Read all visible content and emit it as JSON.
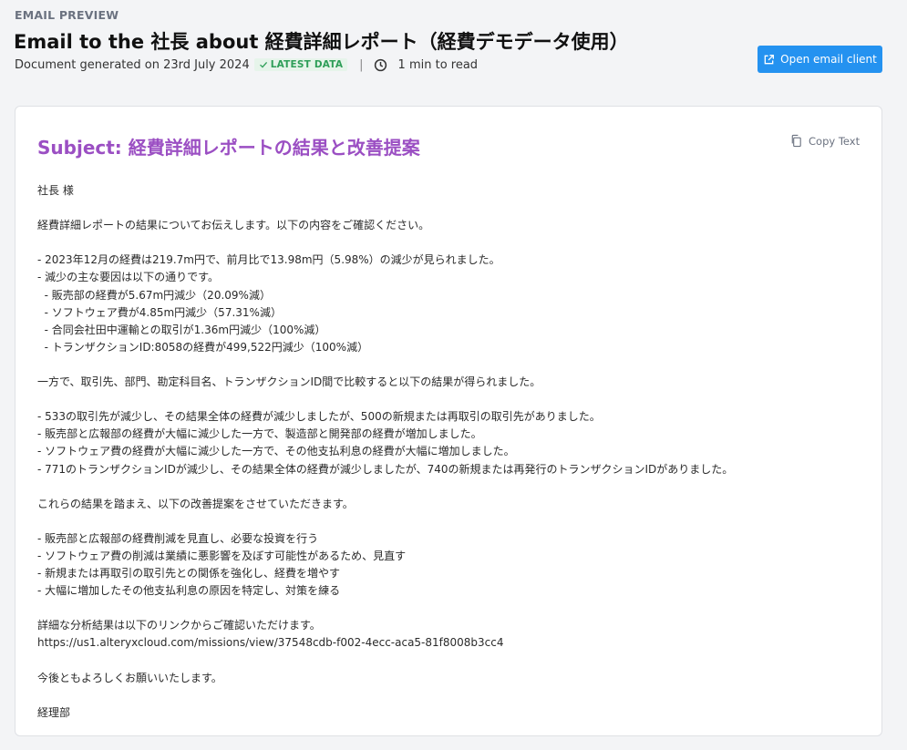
{
  "header": {
    "eyebrow": "EMAIL PREVIEW",
    "title": "Email to the 社長 about 経費詳細レポート（経費デモデータ使用）",
    "generated": "Document generated on 23rd July 2024",
    "badge": "LATEST DATA",
    "separator": "|",
    "read_time": "1 min to read",
    "open_client_label": "Open email client",
    "accent_color": "#2492f0",
    "badge_color": "#2e9e58"
  },
  "email": {
    "subject": "Subject: 経費詳細レポートの結果と改善提案",
    "subject_color": "#9b4fc3",
    "copy_label": "Copy Text",
    "lines": [
      "社長 様",
      "",
      "経費詳細レポートの結果についてお伝えします。以下の内容をご確認ください。",
      "",
      "- 2023年12月の経費は219.7m円で、前月比で13.98m円（5.98%）の減少が見られました。",
      "- 減少の主な要因は以下の通りです。",
      "  - 販売部の経費が5.67m円減少（20.09%減）",
      "  - ソフトウェア費が4.85m円減少（57.31%減）",
      "  - 合同会社田中運輸との取引が1.36m円減少（100%減）",
      "  - トランザクションID:8058の経費が499,522円減少（100%減）",
      "",
      "一方で、取引先、部門、勘定科目名、トランザクションID間で比較すると以下の結果が得られました。",
      "",
      "- 533の取引先が減少し、その結果全体の経費が減少しましたが、500の新規または再取引の取引先がありました。",
      "- 販売部と広報部の経費が大幅に減少した一方で、製造部と開発部の経費が増加しました。",
      "- ソフトウェア費の経費が大幅に減少した一方で、その他支払利息の経費が大幅に増加しました。",
      "- 771のトランザクションIDが減少し、その結果全体の経費が減少しましたが、740の新規または再発行のトランザクションIDがありました。",
      "",
      "これらの結果を踏まえ、以下の改善提案をさせていただきます。",
      "",
      "- 販売部と広報部の経費削減を見直し、必要な投資を行う",
      "- ソフトウェア費の削減は業績に悪影響を及ぼす可能性があるため、見直す",
      "- 新規または再取引の取引先との関係を強化し、経費を増やす",
      "- 大幅に増加したその他支払利息の原因を特定し、対策を練る",
      "",
      "詳細な分析結果は以下のリンクからご確認いただけます。",
      "https://us1.alteryxcloud.com/missions/view/37548cdb-f002-4ecc-aca5-81f8008b3cc4",
      "",
      "今後ともよろしくお願いいたします。",
      "",
      "経理部"
    ]
  }
}
